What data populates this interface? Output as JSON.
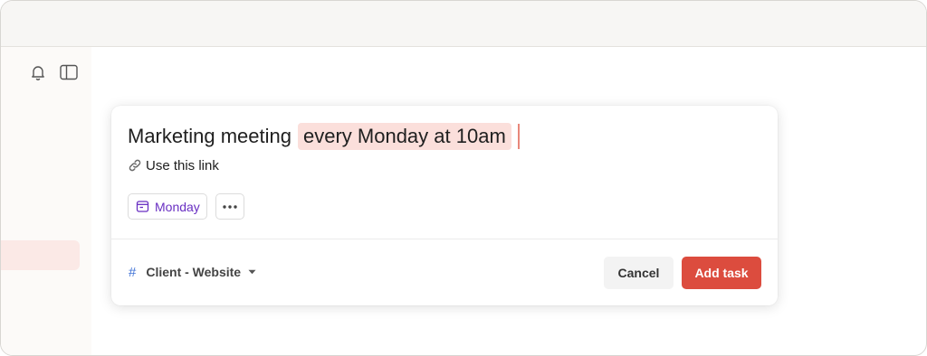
{
  "editor": {
    "title_text": "Marketing meeting",
    "recurrence_text": "every Monday at 10am",
    "description": "Use this link",
    "due_chip_label": "Monday"
  },
  "footer": {
    "project_label": "Client - Website",
    "cancel_label": "Cancel",
    "add_label": "Add task"
  },
  "icons": {
    "sidebar": [
      "bell-icon",
      "sidebar-toggle-icon"
    ],
    "editor": [
      "link-icon",
      "calendar-icon",
      "more-icon",
      "hash-icon",
      "chevron-down-icon"
    ]
  },
  "colors": {
    "accent": "#dc4c3e",
    "highlight": "#fbdfdb",
    "date_purple": "#692fc2",
    "project_blue": "#4073d6"
  }
}
